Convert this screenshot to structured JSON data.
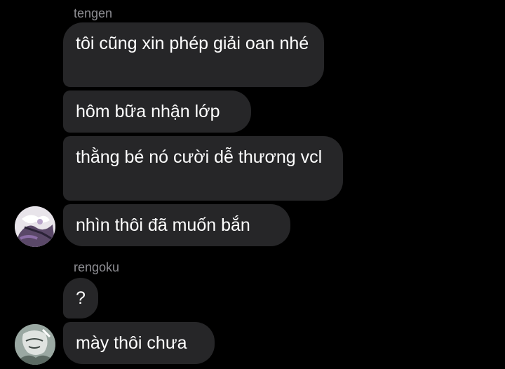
{
  "conversation": {
    "groups": [
      {
        "sender": "tengen",
        "messages": [
          "tôi cũng xin phép giải oan nhé",
          "hôm bữa nhận lớp",
          "thằng bé nó cười dễ thương vcl",
          "nhìn thôi đã muốn bắn"
        ],
        "avatar": "tengen-avatar"
      },
      {
        "sender": "rengoku",
        "messages": [
          "?",
          "mày thôi chưa"
        ],
        "avatar": "rengoku-avatar"
      }
    ]
  },
  "colors": {
    "background": "#000000",
    "bubble": "#262628",
    "sender_label": "#8e8e93",
    "text": "#ffffff"
  }
}
